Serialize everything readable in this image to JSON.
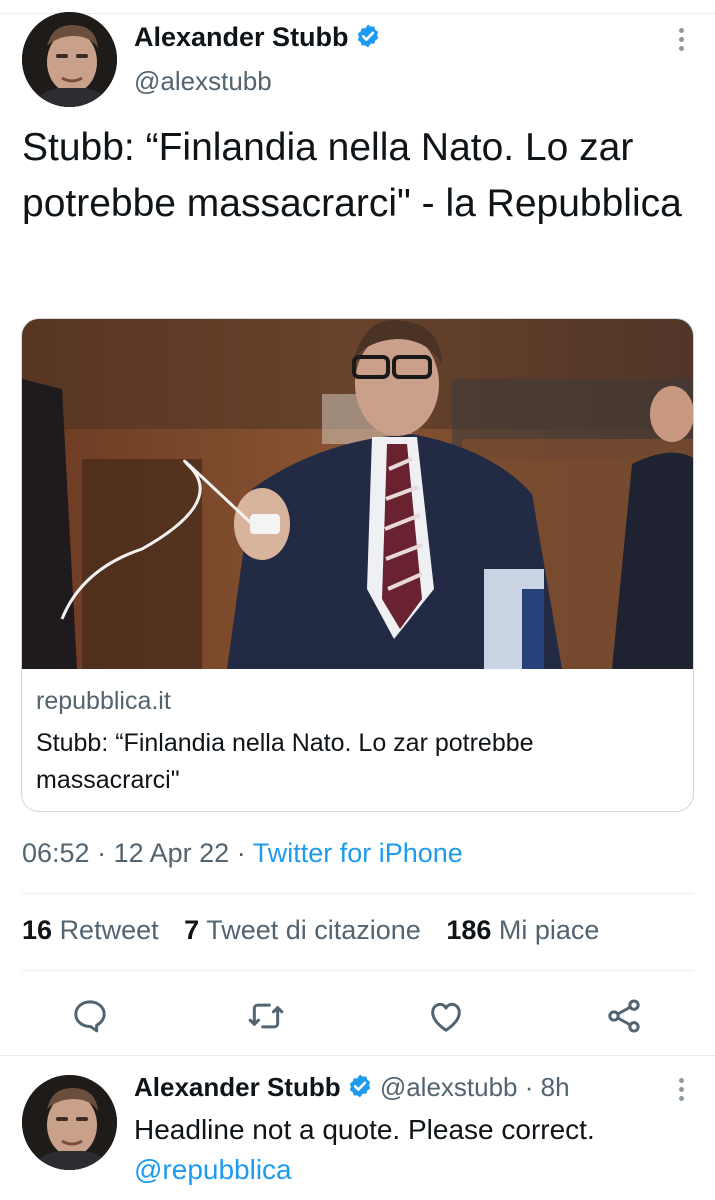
{
  "tweet": {
    "author_name": "Alexander Stubb",
    "author_handle": "@alexstubb",
    "text": "Stubb: “Finlandia nella Nato. Lo zar potrebbe massacrarci\" - la Repubblica",
    "card": {
      "domain": "repubblica.it",
      "title": "Stubb: “Finlandia nella Nato. Lo zar potrebbe massacrarci\""
    },
    "time": "06:52",
    "date": "12 Apr 22",
    "source": "Twitter for iPhone",
    "stats": {
      "retweets_count": "16",
      "retweets_label": "Retweet",
      "quotes_count": "7",
      "quotes_label": "Tweet di citazione",
      "likes_count": "186",
      "likes_label": "Mi piace"
    },
    "actions": [
      "reply-icon",
      "retweet-icon",
      "like-icon",
      "share-icon"
    ]
  },
  "reply": {
    "author_name": "Alexander Stubb",
    "author_handle": "@alexstubb",
    "time": "8h",
    "text": "Headline not a quote. Please correct.",
    "mention": "@repubblica"
  },
  "colors": {
    "accent": "#1d9bf0",
    "secondary_text": "#536471",
    "primary_text": "#0f1419",
    "border": "#cfd9de"
  },
  "separator": "·"
}
